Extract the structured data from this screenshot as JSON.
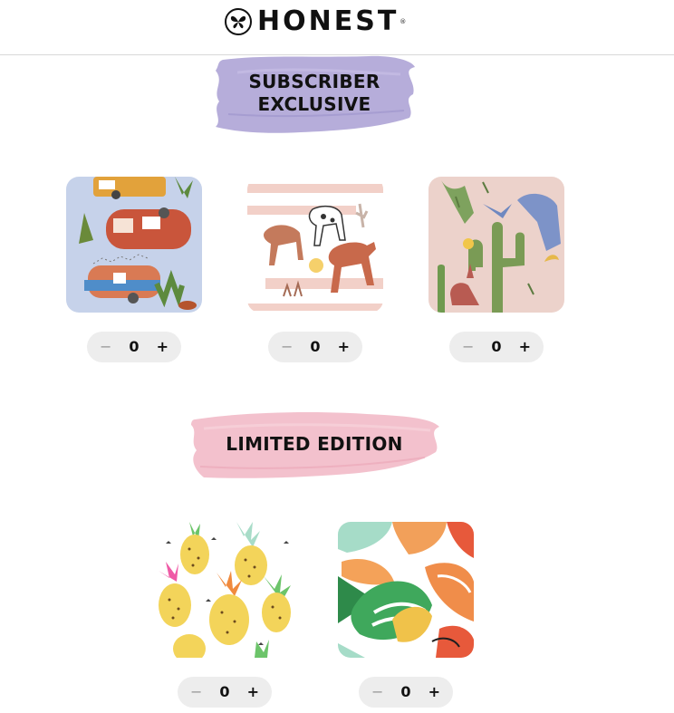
{
  "brand": {
    "name": "HONEST",
    "registered_mark": "®",
    "logo_icon": "butterfly-icon"
  },
  "sections": [
    {
      "heading_lines": [
        "SUBSCRIBER",
        "EXCLUSIVE"
      ],
      "banner_color": "#a99fd3",
      "products": [
        {
          "pattern": "camper-trailers",
          "quantity": "0",
          "minus_label": "−",
          "plus_label": "+"
        },
        {
          "pattern": "horses-desert",
          "quantity": "0",
          "minus_label": "−",
          "plus_label": "+"
        },
        {
          "pattern": "cactus-rabbit",
          "quantity": "0",
          "minus_label": "−",
          "plus_label": "+"
        }
      ]
    },
    {
      "heading_lines": [
        "LIMITED EDITION"
      ],
      "banner_color": "#f1b6c4",
      "products": [
        {
          "pattern": "pineapples",
          "quantity": "0",
          "minus_label": "−",
          "plus_label": "+"
        },
        {
          "pattern": "tropical-leaves",
          "quantity": "0",
          "minus_label": "−",
          "plus_label": "+"
        }
      ]
    }
  ]
}
